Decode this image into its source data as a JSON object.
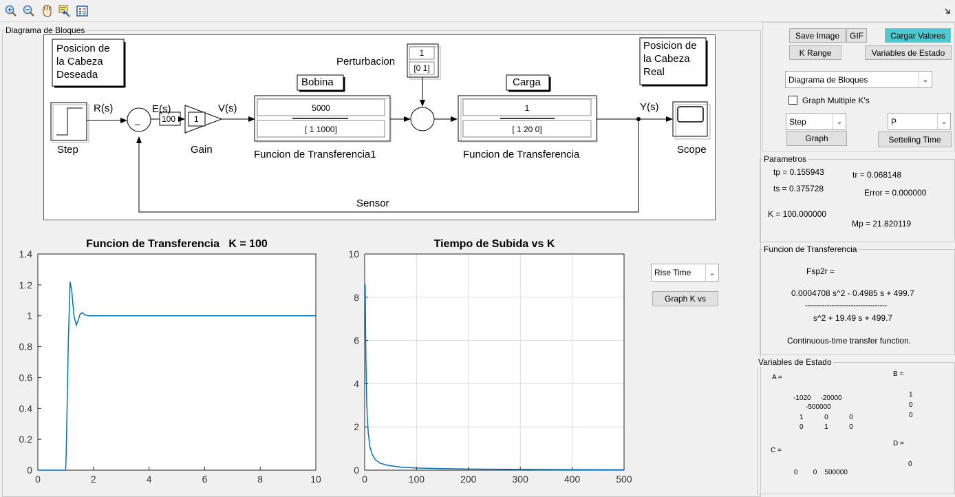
{
  "toolbar": {
    "icons": [
      "zoom-in-icon",
      "zoom-out-icon",
      "pan-hand-icon",
      "data-cursor-icon",
      "legend-icon"
    ],
    "right_icon": "dock-arrow-icon"
  },
  "diagram_panel": {
    "legend": "Diagrama de Bloques",
    "label_posicion_deseada": "Posicion de\nla Cabeza\nDeseada",
    "label_posicion_real": "Posicion de\nla Cabeza\nReal",
    "step_label": "Step",
    "r_signal": "R(s)",
    "e_signal": "E(s)",
    "error_gain_value": "100",
    "gain_value": "1",
    "gain_label": "Gain",
    "v_signal": "V(s)",
    "bobina_label": "Bobina",
    "tf1_num": "5000",
    "tf1_den": "[ 1 1000]",
    "tf1_name": "Funcion de Transferencia1",
    "perturbacion_label": "Perturbacion",
    "pert_num": "1",
    "pert_den": "[0 1]",
    "carga_label": "Carga",
    "tf2_num": "1",
    "tf2_den": "[ 1 20 0]",
    "tf2_name": "Funcion de Transferencia",
    "y_signal": "Y(s)",
    "scope_label": "Scope",
    "sensor_label": "Sensor",
    "minus_sign": "_"
  },
  "plot1": {
    "title": "Funcion de Transferencia   K = 100"
  },
  "plot2": {
    "title": "Tiempo de Subida vs K"
  },
  "middle_controls": {
    "metric_select": "Rise Time",
    "graph_k_button": "Graph K vs"
  },
  "right_panel": {
    "save_image": "Save Image",
    "gif": "GIF",
    "cargar_valores": "Cargar Valores",
    "k_range": "K Range",
    "variables_estado_btn": "Variables de Estado",
    "view_select": "Diagrama de Bloques",
    "graph_multiple": "Graph Multiple K's",
    "input_select": "Step",
    "controller_select": "P",
    "graph_button": "Graph",
    "setteling_button": "Setteling Time",
    "accent_color": "#4fc8d0"
  },
  "parametros": {
    "legend": "Parametros",
    "tp": "tp = 0.155943",
    "tr": "tr = 0.068148",
    "ts": "ts = 0.375728",
    "error": "Error = 0.000000",
    "k": "K = 100.000000",
    "mp": "Mp = 21.820119"
  },
  "funcion_transferencia": {
    "legend": "Funcion de Transferencia",
    "name": "Fsp2r =",
    "numerator": "0.0004708 s^2 - 0.4985 s + 499.7",
    "fraction_bar": "----------------------------------",
    "denominator": "s^2 + 19.49 s + 499.7",
    "note": "Continuous-time transfer function."
  },
  "variables_estado": {
    "legend": "Variables de Estado",
    "a_label": "A =",
    "a_row1": "-1020     -20000",
    "a_row1b": "-500000",
    "a_row2": "1           0           0",
    "a_row3": "0           1           0",
    "b_label": "B =",
    "b_col": [
      "1",
      "0",
      "0"
    ],
    "c_label": "C =",
    "c_row": "0        0    500000",
    "d_label": "D =",
    "d_val": "0"
  },
  "chart_data": [
    {
      "type": "line",
      "title": "Funcion de Transferencia   K = 100",
      "xlabel": "",
      "ylabel": "",
      "xlim": [
        0,
        10
      ],
      "ylim": [
        0,
        1.4
      ],
      "xticks": [
        "0",
        "2",
        "4",
        "6",
        "8",
        "10"
      ],
      "yticks": [
        "0",
        "0.2",
        "0.4",
        "0.6",
        "0.8",
        "1",
        "1.2",
        "1.4"
      ],
      "series": [
        {
          "color": "#0072bd",
          "x": [
            0,
            1.0,
            1.02,
            1.1,
            1.16,
            1.22,
            1.3,
            1.38,
            1.45,
            1.52,
            1.6,
            1.7,
            1.85,
            2.0,
            10
          ],
          "y": [
            0,
            0,
            0.1,
            0.85,
            1.22,
            1.16,
            1.0,
            0.94,
            0.97,
            1.01,
            1.02,
            1.005,
            1.0,
            1.0,
            1.0
          ]
        }
      ],
      "grid": false
    },
    {
      "type": "line",
      "title": "Tiempo de Subida vs K",
      "xlabel": "",
      "ylabel": "",
      "xlim": [
        0,
        500
      ],
      "ylim": [
        0,
        10
      ],
      "xticks": [
        "0",
        "100",
        "200",
        "300",
        "400",
        "500"
      ],
      "yticks": [
        "0",
        "2",
        "4",
        "6",
        "8",
        "10"
      ],
      "series": [
        {
          "color": "#0072bd",
          "x": [
            1,
            2,
            3,
            4,
            5,
            7,
            10,
            14,
            20,
            30,
            45,
            70,
            100,
            150,
            200,
            300,
            400,
            500
          ],
          "y": [
            8.6,
            6.0,
            4.3,
            3.2,
            2.5,
            1.7,
            1.1,
            0.75,
            0.5,
            0.32,
            0.22,
            0.14,
            0.1,
            0.07,
            0.05,
            0.035,
            0.026,
            0.02
          ]
        }
      ],
      "grid": true
    }
  ]
}
